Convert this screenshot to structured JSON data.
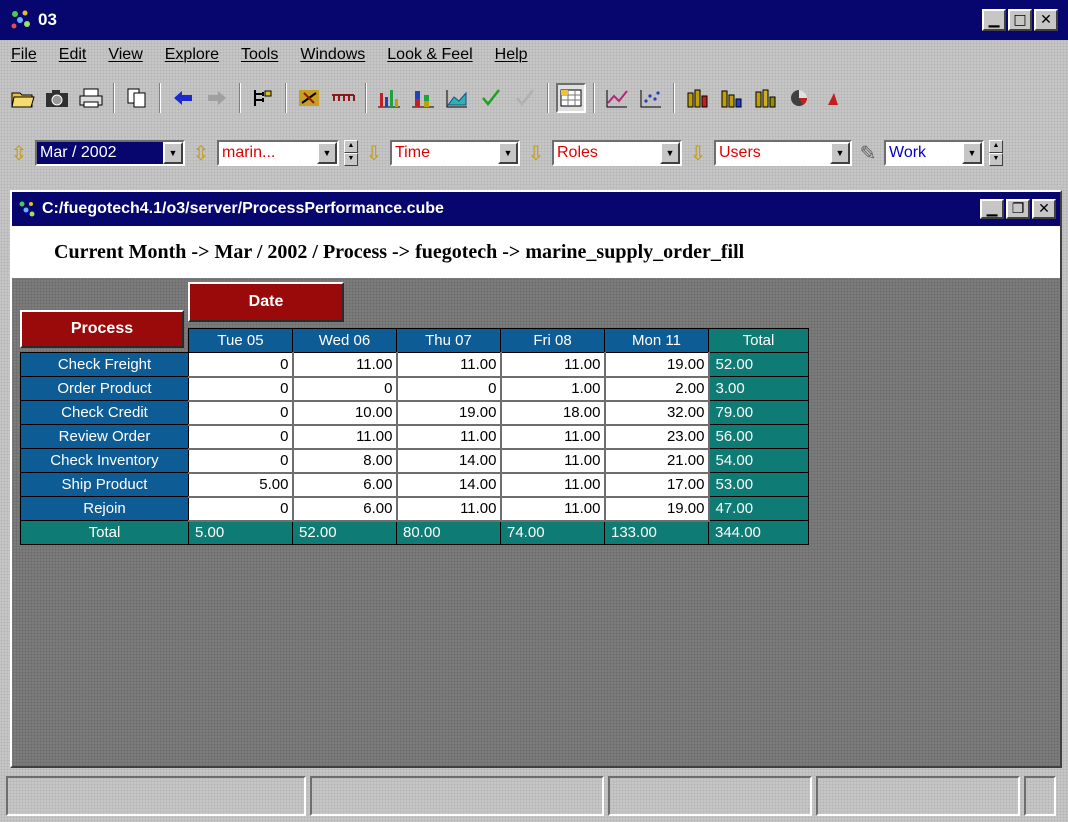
{
  "window": {
    "title": "03",
    "controls": {
      "minimize": "▁",
      "maximize": "□",
      "close": "✕"
    }
  },
  "menu": [
    "File",
    "Edit",
    "View",
    "Explore",
    "Tools",
    "Windows",
    "Look & Feel",
    "Help"
  ],
  "toolbar": {
    "icons": [
      "open-icon",
      "camera-icon",
      "print-icon",
      "copy-icon",
      "back-arrow-icon",
      "forward-arrow-icon",
      "hierarchy-icon",
      "swap-axes-icon",
      "filter-icon",
      "bar-chart-icon",
      "stacked-bar-chart-icon",
      "area-chart-icon",
      "check-icon",
      "uncheck-icon",
      "grid-view-icon",
      "line-chart-icon",
      "scatter-chart-icon",
      "3d-bar-chart-icon",
      "3d-bar-chart-alt-icon",
      "3d-column-chart-icon",
      "pie-chart-icon",
      "more-chart-icon"
    ]
  },
  "filters": {
    "month": "Mar / 2002",
    "process": "marin...",
    "time": "Time",
    "roles": "Roles",
    "users": "Users",
    "work": "Work"
  },
  "inner_window": {
    "title": "C:/fuegotech4.1/o3/server/ProcessPerformance.cube",
    "context": "Current Month -> Mar / 2002 / Process -> fuegotech -> marine_supply_order_fill"
  },
  "pivot": {
    "column_dim": "Date",
    "row_dim": "Process",
    "columns": [
      "Tue 05",
      "Wed 06",
      "Thu 07",
      "Fri 08",
      "Mon 11"
    ],
    "total_label": "Total",
    "rows": [
      {
        "label": "Check Freight",
        "values": [
          "0",
          "11.00",
          "11.00",
          "11.00",
          "19.00"
        ],
        "total": "52.00"
      },
      {
        "label": "Order Product",
        "values": [
          "0",
          "0",
          "0",
          "1.00",
          "2.00"
        ],
        "total": "3.00"
      },
      {
        "label": "Check Credit",
        "values": [
          "0",
          "10.00",
          "19.00",
          "18.00",
          "32.00"
        ],
        "total": "79.00"
      },
      {
        "label": "Review Order",
        "values": [
          "0",
          "11.00",
          "11.00",
          "11.00",
          "23.00"
        ],
        "total": "56.00"
      },
      {
        "label": "Check Inventory",
        "values": [
          "0",
          "8.00",
          "14.00",
          "11.00",
          "21.00"
        ],
        "total": "54.00"
      },
      {
        "label": "Ship Product",
        "values": [
          "5.00",
          "6.00",
          "14.00",
          "11.00",
          "17.00"
        ],
        "total": "53.00"
      },
      {
        "label": "Rejoin",
        "values": [
          "0",
          "6.00",
          "11.00",
          "11.00",
          "19.00"
        ],
        "total": "47.00"
      }
    ],
    "totals": [
      "5.00",
      "52.00",
      "80.00",
      "74.00",
      "133.00"
    ],
    "grand_total": "344.00"
  },
  "colors": {
    "title_bar": "#06066e",
    "header_blue": "#0d5c95",
    "total_teal": "#0e7c74",
    "dimension_red": "#9a0a0a"
  }
}
